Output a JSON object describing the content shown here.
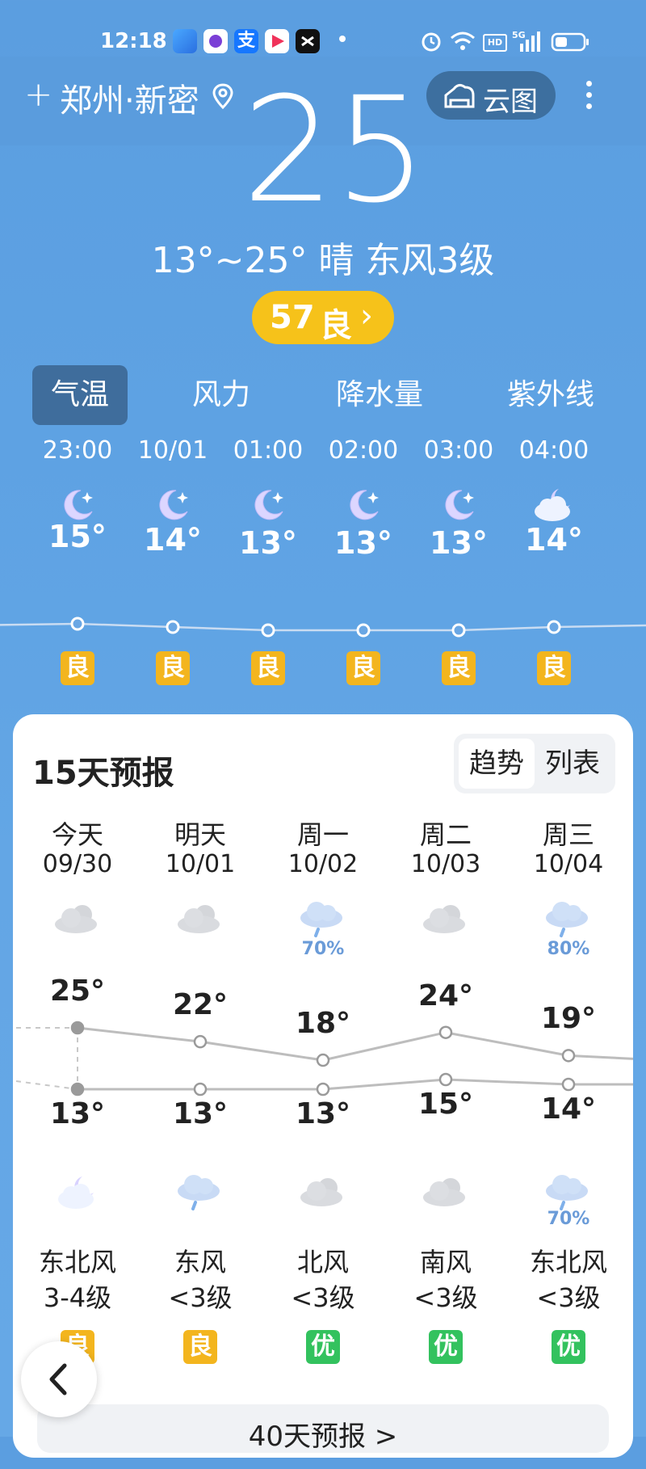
{
  "status_bar": {
    "time": "12:18",
    "apps": [
      "app-blue",
      "app-purple",
      "alipay",
      "app-redplay",
      "capcut"
    ],
    "icons": [
      "alarm-icon",
      "wifi-icon",
      "hd-icon",
      "5g-signal-icon",
      "battery-icon"
    ]
  },
  "header": {
    "add": "+",
    "city": "郑州·新密",
    "cloud_button": "云图"
  },
  "current": {
    "temp": "25",
    "summary": "13°~25° 晴 东风3级",
    "aqi_value": "57",
    "aqi_level": "良"
  },
  "tabs": [
    "气温",
    "风力",
    "降水量",
    "紫外线"
  ],
  "hourly": [
    {
      "time": "23:00",
      "icon": "moon-icon",
      "temp": "15°",
      "temp_value": 15,
      "aqi": "良"
    },
    {
      "time": "10/01",
      "icon": "moon-icon",
      "temp": "14°",
      "temp_value": 14,
      "aqi": "良"
    },
    {
      "time": "01:00",
      "icon": "moon-icon",
      "temp": "13°",
      "temp_value": 13,
      "aqi": "良"
    },
    {
      "time": "02:00",
      "icon": "moon-icon",
      "temp": "13°",
      "temp_value": 13,
      "aqi": "良"
    },
    {
      "time": "03:00",
      "icon": "moon-icon",
      "temp": "13°",
      "temp_value": 13,
      "aqi": "良"
    },
    {
      "time": "04:00",
      "icon": "cloudy-night-icon",
      "temp": "14°",
      "temp_value": 14,
      "aqi": "良"
    }
  ],
  "forecast": {
    "title": "15天预报",
    "toggle": [
      "趋势",
      "列表"
    ],
    "days": [
      {
        "name": "今天",
        "date": "09/30",
        "day_icon": "cloudy-icon",
        "day_pct": "",
        "high": "25°",
        "high_value": 25,
        "low": "13°",
        "low_value": 13,
        "night_icon": "cloudy-night-icon",
        "night_pct": "",
        "wind_dir": "东北风",
        "wind_level": "3-4级",
        "aqi": "良"
      },
      {
        "name": "明天",
        "date": "10/01",
        "day_icon": "cloudy-icon",
        "day_pct": "",
        "high": "22°",
        "high_value": 22,
        "low": "13°",
        "low_value": 13,
        "night_icon": "light-rain-icon",
        "night_pct": "",
        "wind_dir": "东风",
        "wind_level": "<3级",
        "aqi": "良"
      },
      {
        "name": "周一",
        "date": "10/02",
        "day_icon": "rain-icon",
        "day_pct": "70%",
        "high": "18°",
        "high_value": 18,
        "low": "13°",
        "low_value": 13,
        "night_icon": "cloudy-icon",
        "night_pct": "",
        "wind_dir": "北风",
        "wind_level": "<3级",
        "aqi": "优"
      },
      {
        "name": "周二",
        "date": "10/03",
        "day_icon": "cloudy-icon",
        "day_pct": "",
        "high": "24°",
        "high_value": 24,
        "low": "15°",
        "low_value": 15,
        "night_icon": "cloudy-icon",
        "night_pct": "",
        "wind_dir": "南风",
        "wind_level": "<3级",
        "aqi": "优"
      },
      {
        "name": "周三",
        "date": "10/04",
        "day_icon": "rain-icon",
        "day_pct": "80%",
        "high": "19°",
        "high_value": 19,
        "low": "14°",
        "low_value": 14,
        "night_icon": "rain-icon",
        "night_pct": "70%",
        "wind_dir": "东北风",
        "wind_level": "<3级",
        "aqi": "优"
      }
    ],
    "more_button": "40天预报 >"
  },
  "colors": {
    "aqi_good": "#f3b51e",
    "aqi_excellent": "#33c25e",
    "sky": "#5b9ee0"
  }
}
